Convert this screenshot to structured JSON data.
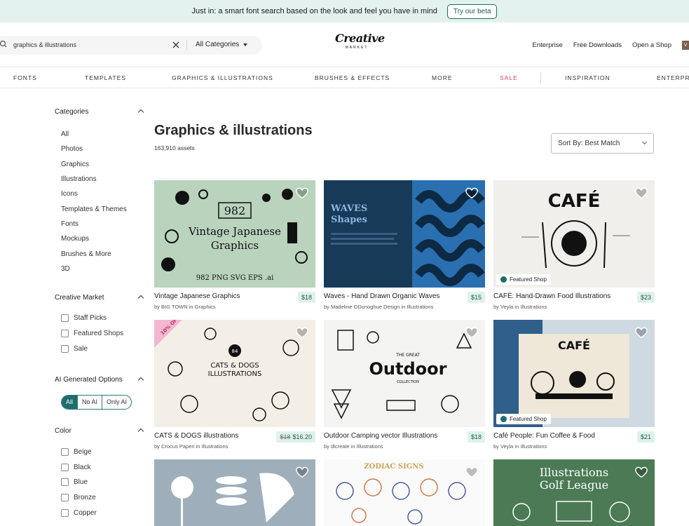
{
  "banner": {
    "text": "Just in: a smart font search based on the look and feel you have in mind",
    "button": "Try our beta"
  },
  "header": {
    "search_value": "graphics & illustrations",
    "category_select": "All Categories",
    "logo_main": "Creative",
    "logo_sub": "MARKET",
    "links": [
      "Enterprise",
      "Free Downloads",
      "Open a Shop"
    ],
    "avatar_letter": "V"
  },
  "nav": [
    "FONTS",
    "TEMPLATES",
    "GRAPHICS & ILLUSTRATIONS",
    "BRUSHES & EFFECTS",
    "MORE",
    "SALE",
    "INSPIRATION",
    "ENTERPRISE"
  ],
  "sidebar": {
    "categories_title": "Categories",
    "categories": [
      "All",
      "Photos",
      "Graphics",
      "Illustrations",
      "Icons",
      "Templates & Themes",
      "Fonts",
      "Mockups",
      "Brushes & More",
      "3D"
    ],
    "cm_title": "Creative Market",
    "cm_options": [
      "Staff Picks",
      "Featured Shops",
      "Sale"
    ],
    "ai_title": "AI Generated Options",
    "ai_options": [
      "All",
      "No AI",
      "Only AI"
    ],
    "color_title": "Color",
    "colors": [
      "Beige",
      "Black",
      "Blue",
      "Bronze",
      "Copper"
    ]
  },
  "main": {
    "title": "Graphics & illustrations",
    "count": "163,910 assets",
    "sort": "Sort By: Best Match",
    "products": [
      {
        "title": "Vintage Japanese Graphics",
        "by": "by BIG TOWN in Graphics",
        "price": "$18",
        "featured": false,
        "img": {
          "title": "Vintage Japanese Graphics",
          "number": "982",
          "formats": "982 PNG SVG EPS .ai"
        }
      },
      {
        "title": "Waves - Hand Drawn Organic Waves",
        "by": "by Madeline ODonoghue Design in Illustrations",
        "price": "$15",
        "featured": false,
        "img": {
          "title": "WAVES Shapes"
        }
      },
      {
        "title": "CAFÉ: Hand-Drawn Food Illustrations",
        "by": "by Veyla in Illustrations",
        "price": "$23",
        "featured": true,
        "img": {
          "title": "CAFÉ"
        }
      },
      {
        "title": "CATS & DOGS illustrations",
        "by": "by Crocus Paperi in Illustrations",
        "old_price": "$18",
        "price": "$16.20",
        "featured": false,
        "img": {
          "title": "CATS & DOGS ILLUSTRATIONS",
          "number": "84",
          "badge": "10% OFF"
        }
      },
      {
        "title": "Outdoor Camping vector Illustrations",
        "by": "by dlcreate in Illustrations",
        "price": "$18",
        "featured": false,
        "img": {
          "title": "Outdoor",
          "pre": "THE GREAT",
          "post": "COLLECTION"
        }
      },
      {
        "title": "Café People: Fun Coffee & Food",
        "by": "by Veyla in Illustrations",
        "price": "$21",
        "featured": true,
        "img": {
          "title": "CAFÉ"
        }
      },
      {
        "title": "",
        "by": "",
        "price": "",
        "featured": false,
        "img": {
          "title": ""
        }
      },
      {
        "title": "",
        "by": "",
        "price": "",
        "featured": false,
        "img": {
          "title": "ZODIAC SIGNS"
        }
      },
      {
        "title": "",
        "by": "",
        "price": "",
        "featured": false,
        "img": {
          "title": "Illustrations Golf League"
        }
      }
    ],
    "featured_label": "Featured Shop"
  },
  "colors": {
    "accent": "#1f6c6c",
    "banner_bg": "#e3f2ee",
    "sale": "#d1465a",
    "price_bg": "#dff2ea"
  }
}
